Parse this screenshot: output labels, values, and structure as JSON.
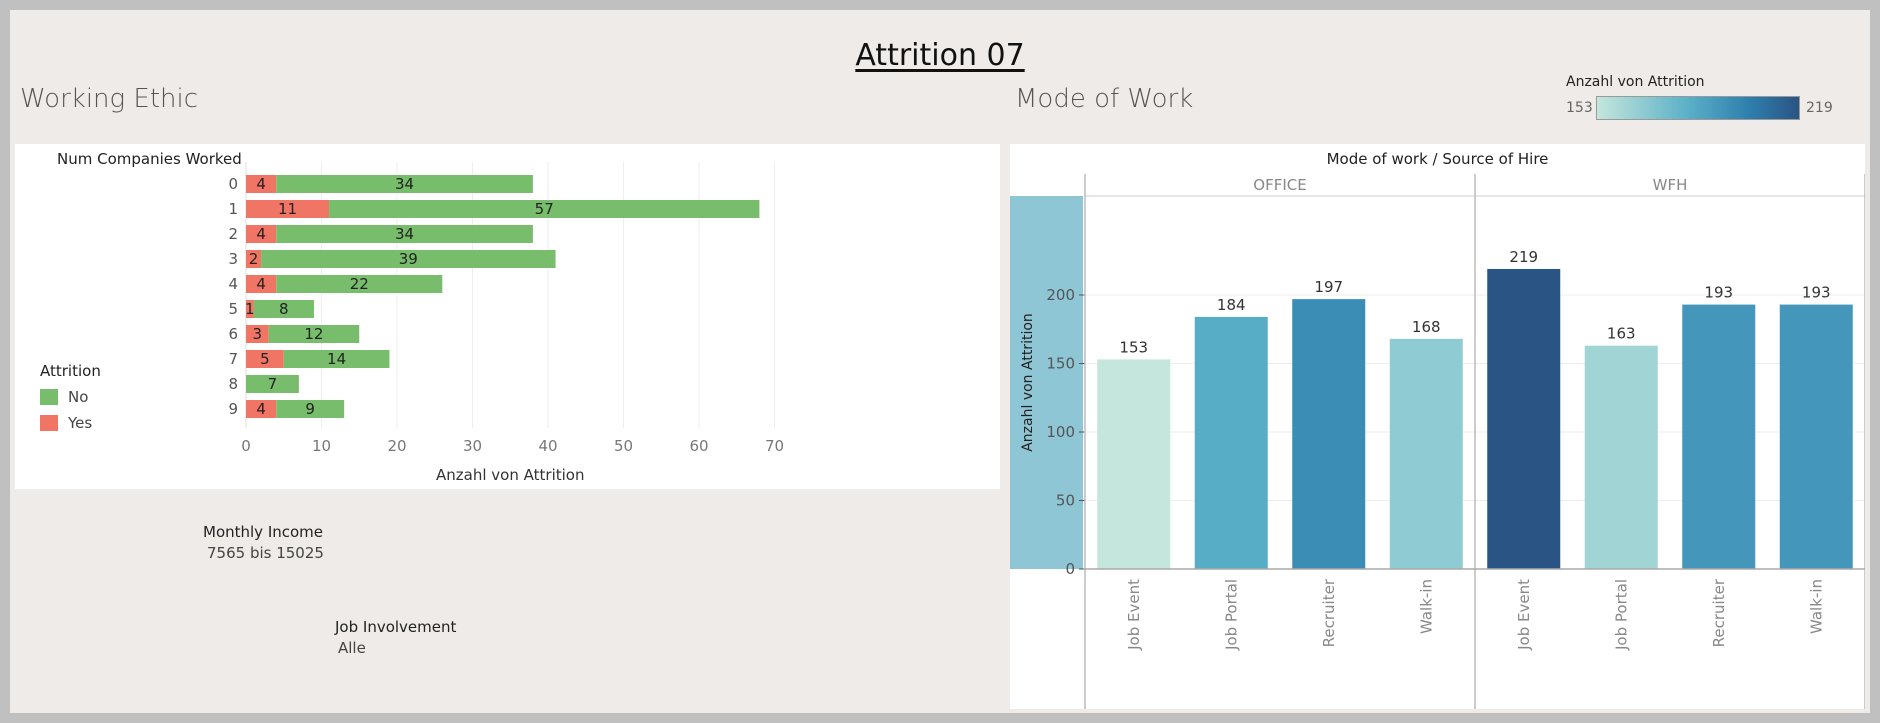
{
  "dashboard": {
    "title": "Attrition 07"
  },
  "working_ethic": {
    "title": "Working Ethic",
    "row_header": "Num Companies Worked",
    "legend": {
      "title": "Attrition",
      "items": [
        {
          "label": "No",
          "color": "#77bd6b"
        },
        {
          "label": "Yes",
          "color": "#f07565"
        }
      ]
    }
  },
  "mode_of_work": {
    "title": "Mode of Work",
    "header": "Mode of work  /  Source of Hire",
    "color_legend": {
      "title": "Anzahl von Attrition",
      "min": "153",
      "max": "219"
    }
  },
  "filters": [
    {
      "title": "Monthly Income",
      "value": "7565 bis 15025"
    },
    {
      "title": "Job Involvement",
      "value": "Alle"
    }
  ],
  "chart_data": [
    {
      "type": "bar",
      "orientation": "horizontal",
      "stacked": true,
      "categories": [
        "0",
        "1",
        "2",
        "3",
        "4",
        "5",
        "6",
        "7",
        "8",
        "9"
      ],
      "series": [
        {
          "name": "Yes",
          "color": "#f07565",
          "values": [
            4,
            11,
            4,
            2,
            4,
            1,
            3,
            5,
            0,
            4
          ]
        },
        {
          "name": "No",
          "color": "#77bd6b",
          "values": [
            34,
            57,
            34,
            39,
            22,
            8,
            12,
            14,
            7,
            9
          ]
        }
      ],
      "xlabel": "Anzahl von Attrition",
      "ylabel": "Num Companies Worked",
      "xlim": [
        0,
        70
      ],
      "xticks": [
        0,
        10,
        20,
        30,
        40,
        50,
        60,
        70
      ],
      "grid": true,
      "legend": "left"
    },
    {
      "type": "bar",
      "groups": [
        {
          "name": "OFFICE",
          "categories": [
            "Job Event",
            "Job Portal",
            "Recruiter",
            "Walk-in"
          ],
          "values": [
            153,
            184,
            197,
            168
          ]
        },
        {
          "name": "WFH",
          "categories": [
            "Job Event",
            "Job Portal",
            "Recruiter",
            "Walk-in"
          ],
          "values": [
            219,
            163,
            193,
            193
          ]
        }
      ],
      "ylabel": "Anzahl von Attrition",
      "ylim": [
        0,
        230
      ],
      "yticks": [
        0,
        50,
        100,
        150,
        200
      ],
      "color_scale": {
        "min": 153,
        "max": 219,
        "from": "#c4e6dc",
        "to": "#2a5484"
      },
      "grid": true
    }
  ]
}
